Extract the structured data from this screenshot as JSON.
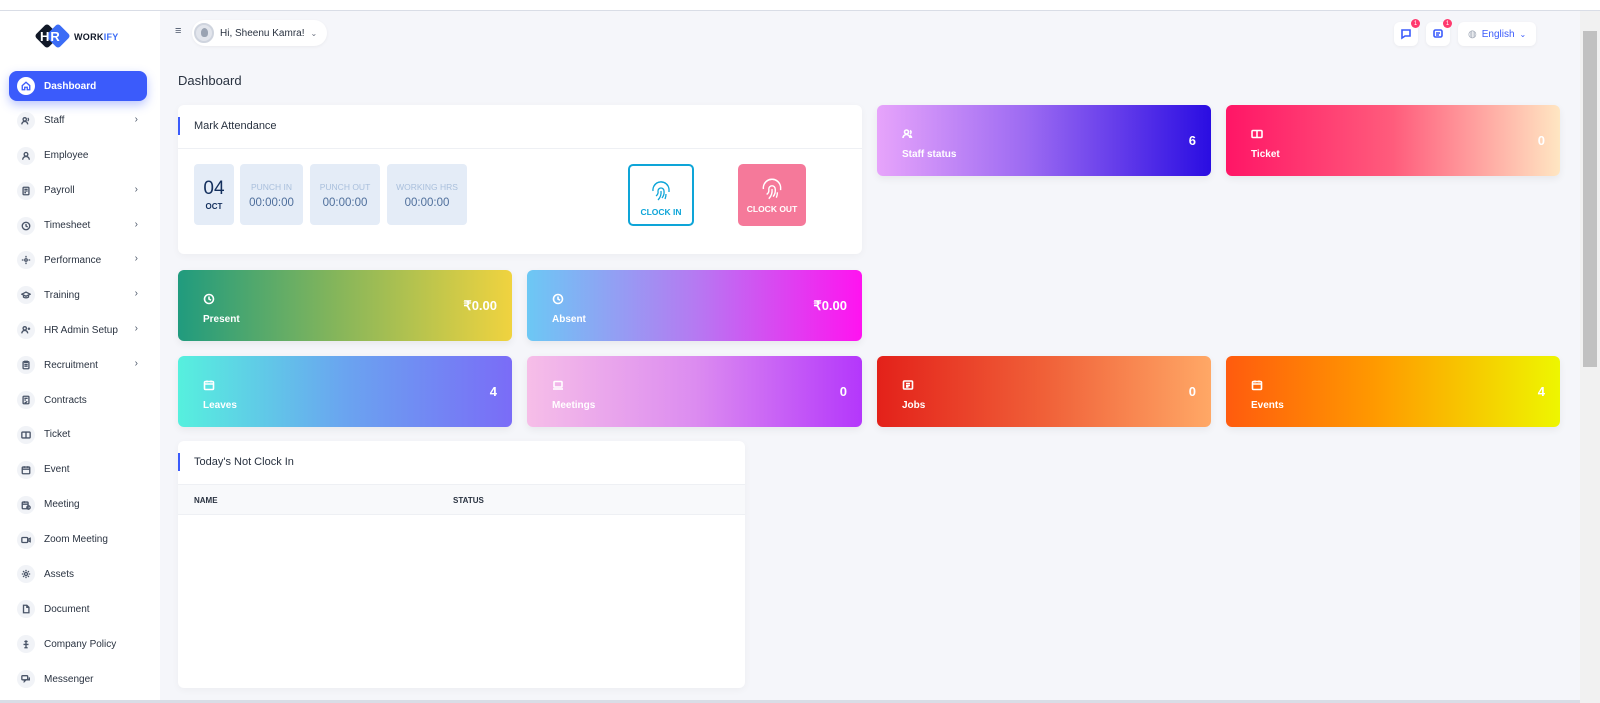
{
  "brand": {
    "logo_mark": "HR",
    "logo_text_a": "WORK",
    "logo_text_b": "IFY"
  },
  "sidebar": {
    "items": [
      {
        "label": "Dashboard",
        "icon": "home-icon",
        "has_chevron": false,
        "active": true
      },
      {
        "label": "Staff",
        "icon": "users-icon",
        "has_chevron": true
      },
      {
        "label": "Employee",
        "icon": "user-icon",
        "has_chevron": false
      },
      {
        "label": "Payroll",
        "icon": "receipt-icon",
        "has_chevron": true
      },
      {
        "label": "Timesheet",
        "icon": "clock-icon",
        "has_chevron": true
      },
      {
        "label": "Performance",
        "icon": "performance-icon",
        "has_chevron": true
      },
      {
        "label": "Training",
        "icon": "graduation-cap-icon",
        "has_chevron": true
      },
      {
        "label": "HR Admin Setup",
        "icon": "user-plus-icon",
        "has_chevron": true
      },
      {
        "label": "Recruitment",
        "icon": "clipboard-icon",
        "has_chevron": true
      },
      {
        "label": "Contracts",
        "icon": "contract-icon",
        "has_chevron": false
      },
      {
        "label": "Ticket",
        "icon": "ticket-icon",
        "has_chevron": false
      },
      {
        "label": "Event",
        "icon": "calendar-icon",
        "has_chevron": false
      },
      {
        "label": "Meeting",
        "icon": "calendar-time-icon",
        "has_chevron": false
      },
      {
        "label": "Zoom Meeting",
        "icon": "video-icon",
        "has_chevron": false
      },
      {
        "label": "Assets",
        "icon": "gear-icon",
        "has_chevron": false
      },
      {
        "label": "Document",
        "icon": "file-icon",
        "has_chevron": false
      },
      {
        "label": "Company Policy",
        "icon": "policy-icon",
        "has_chevron": false
      },
      {
        "label": "Messenger",
        "icon": "message-icon",
        "has_chevron": false
      }
    ],
    "chevron": "›"
  },
  "header": {
    "menu_icon": "≡",
    "greeting": "Hi, Sheenu Kamra!",
    "caret": "⌄",
    "messages_badge": "1",
    "notifications_badge": "1",
    "language": "English"
  },
  "page": {
    "title": "Dashboard"
  },
  "attendance": {
    "title": "Mark Attendance",
    "day": "04",
    "month": "OCT",
    "punch_in_label": "PUNCH IN",
    "punch_in_value": "00:00:00",
    "punch_out_label": "PUNCH OUT",
    "punch_out_value": "00:00:00",
    "working_hrs_label": "WORKING HRS",
    "working_hrs_value": "00:00:00",
    "clock_in_label": "CLOCK IN",
    "clock_out_label": "CLOCK OUT"
  },
  "stats": {
    "staff_status": {
      "label": "Staff status",
      "value": "6"
    },
    "ticket": {
      "label": "Ticket",
      "value": "0"
    },
    "present": {
      "label": "Present",
      "value": "₹0.00"
    },
    "absent": {
      "label": "Absent",
      "value": "₹0.00"
    },
    "leaves": {
      "label": "Leaves",
      "value": "4"
    },
    "meetings": {
      "label": "Meetings",
      "value": "0"
    },
    "jobs": {
      "label": "Jobs",
      "value": "0"
    },
    "events": {
      "label": "Events",
      "value": "4"
    }
  },
  "not_clock_in": {
    "title": "Today's Not Clock In",
    "columns": [
      "NAME",
      "STATUS"
    ],
    "rows": []
  },
  "colors": {
    "accent": "#3b5bfb",
    "clock_in": "#0ea5d8",
    "clock_out": "#f5799a"
  }
}
